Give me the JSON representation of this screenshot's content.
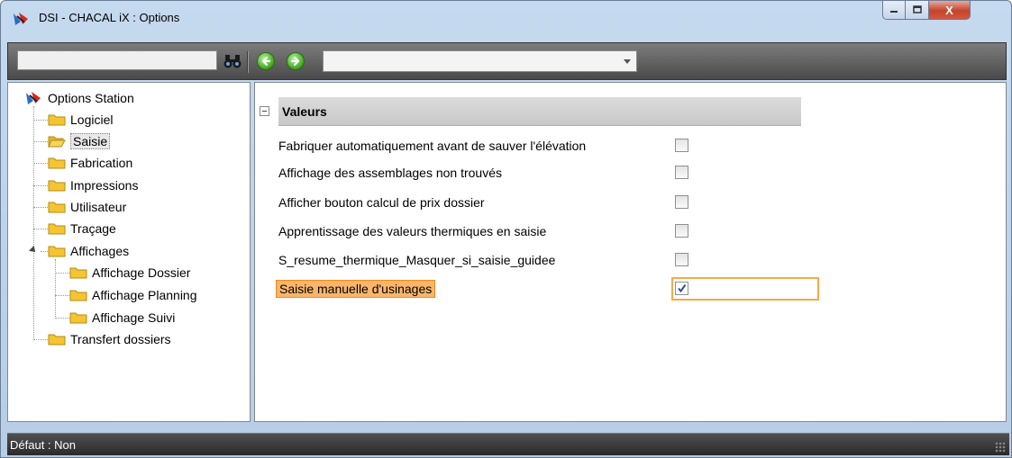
{
  "window": {
    "title": "DSI - CHACAL iX : Options",
    "minimize_label": "",
    "maximize_label": "",
    "close_label": "X"
  },
  "toolbar": {
    "search_value": "",
    "combo_value": ""
  },
  "tree": {
    "root": "Options Station",
    "items": [
      {
        "label": "Logiciel"
      },
      {
        "label": "Saisie"
      },
      {
        "label": "Fabrication"
      },
      {
        "label": "Impressions"
      },
      {
        "label": "Utilisateur"
      },
      {
        "label": "Traçage"
      },
      {
        "label": "Affichages"
      },
      {
        "label": "Affichage Dossier"
      },
      {
        "label": "Affichage Planning"
      },
      {
        "label": "Affichage Suivi"
      },
      {
        "label": "Transfert dossiers"
      }
    ]
  },
  "properties": {
    "group": "Valeurs",
    "rows": [
      {
        "label": "Fabriquer automatiquement avant de sauver l'élévation",
        "checked": false
      },
      {
        "label": "Affichage des assemblages non trouvés",
        "checked": false
      },
      {
        "label": "Afficher bouton calcul de prix dossier",
        "checked": false
      },
      {
        "label": "Apprentissage des valeurs thermiques en saisie",
        "checked": false
      },
      {
        "label": "S_resume_thermique_Masquer_si_saisie_guidee",
        "checked": false
      },
      {
        "label": "Saisie manuelle d'usinages",
        "checked": true
      }
    ]
  },
  "status": {
    "text": "Défaut : Non"
  },
  "colors": {
    "selection_fill": "#f9b66b",
    "selection_border": "#f28a1c",
    "folder": "#f5c531"
  }
}
